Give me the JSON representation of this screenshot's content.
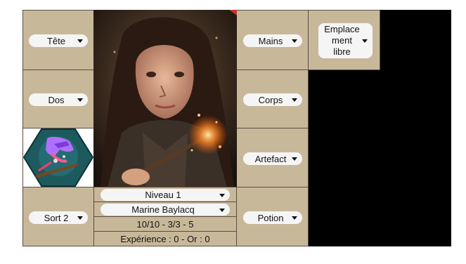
{
  "slots": {
    "head": {
      "label": "Tête"
    },
    "hands": {
      "label": "Mains"
    },
    "free_slot": {
      "line1": "Emplace",
      "line2": "ment",
      "line3": "libre"
    },
    "back": {
      "label": "Dos"
    },
    "body": {
      "label": "Corps"
    },
    "artifact": {
      "label": "Artefact"
    },
    "spell2": {
      "label": "Sort 2"
    },
    "potion": {
      "label": "Potion"
    }
  },
  "character": {
    "level": "Niveau 1",
    "name": "Marine Baylacq",
    "stats": "10/10 - 3/3 - 5",
    "experience": "Expérience : 0 - Or : 0"
  },
  "colors": {
    "panel": "#c8b89a",
    "border": "#5a4e40",
    "select_bg": "#f5f5f5",
    "spell_hex": "#1d5a5e"
  },
  "icons": {
    "spell1": "magic-hand-wand-icon"
  }
}
